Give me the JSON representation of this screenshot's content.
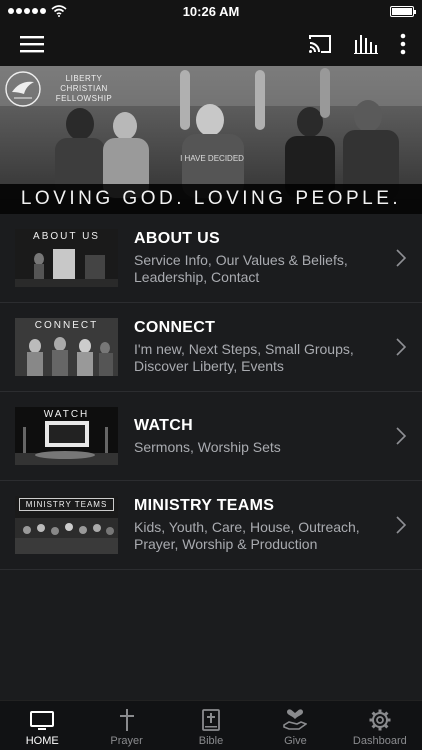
{
  "status": {
    "time": "10:26 AM"
  },
  "hero": {
    "org_name": "LIBERTY CHRISTIAN FELLOWSHIP",
    "tagline": "LOVING GOD.  LOVING PEOPLE.",
    "shirt_text": "I HAVE DECIDED"
  },
  "menu": [
    {
      "thumb_label": "ABOUT US",
      "title": "ABOUT US",
      "subtitle": "Service Info, Our Values & Beliefs, Leadership, Contact"
    },
    {
      "thumb_label": "CONNECT",
      "title": "CONNECT",
      "subtitle": "I'm new, Next Steps, Small Groups, Discover Liberty, Events"
    },
    {
      "thumb_label": "WATCH",
      "title": "WATCH",
      "subtitle": "Sermons, Worship Sets"
    },
    {
      "thumb_label": "MINISTRY TEAMS",
      "title": "MINISTRY TEAMS",
      "subtitle": "Kids, Youth, Care, House, Outreach, Prayer, Worship & Production"
    }
  ],
  "tabs": [
    {
      "label": "HOME",
      "icon": "monitor-icon",
      "active": true
    },
    {
      "label": "Prayer",
      "icon": "cross-icon",
      "active": false
    },
    {
      "label": "Bible",
      "icon": "bible-icon",
      "active": false
    },
    {
      "label": "Give",
      "icon": "give-heart-hand-icon",
      "active": false
    },
    {
      "label": "Dashboard",
      "icon": "gear-icon",
      "active": false
    }
  ],
  "colors": {
    "background": "#1b1c1e",
    "bar": "#141414",
    "muted_text": "#a9abb0"
  }
}
